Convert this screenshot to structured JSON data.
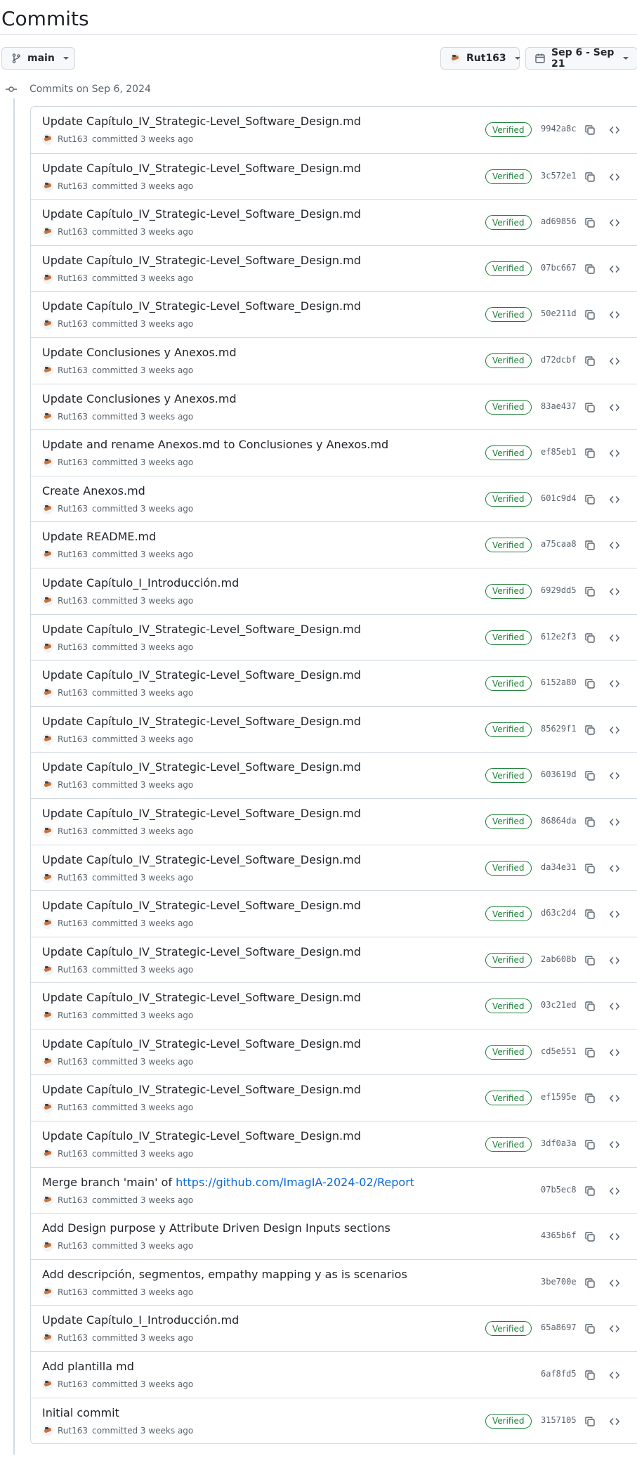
{
  "page": {
    "title": "Commits"
  },
  "filters": {
    "branch_label": "main",
    "author_label": "Rut163",
    "date_label": "Sep 6 - Sep 21"
  },
  "group": {
    "label": "Commits on Sep 6, 2024"
  },
  "commits": [
    {
      "title": "Update Capítulo_IV_Strategic-Level_Software_Design.md",
      "author": "Rut163",
      "meta": "committed 3 weeks ago",
      "verified": "Verified",
      "sha": "9942a8c"
    },
    {
      "title": "Update Capítulo_IV_Strategic-Level_Software_Design.md",
      "author": "Rut163",
      "meta": "committed 3 weeks ago",
      "verified": "Verified",
      "sha": "3c572e1"
    },
    {
      "title": "Update Capítulo_IV_Strategic-Level_Software_Design.md",
      "author": "Rut163",
      "meta": "committed 3 weeks ago",
      "verified": "Verified",
      "sha": "ad69856"
    },
    {
      "title": "Update Capítulo_IV_Strategic-Level_Software_Design.md",
      "author": "Rut163",
      "meta": "committed 3 weeks ago",
      "verified": "Verified",
      "sha": "07bc667"
    },
    {
      "title": "Update Capítulo_IV_Strategic-Level_Software_Design.md",
      "author": "Rut163",
      "meta": "committed 3 weeks ago",
      "verified": "Verified",
      "sha": "50e211d"
    },
    {
      "title": "Update Conclusiones y Anexos.md",
      "author": "Rut163",
      "meta": "committed 3 weeks ago",
      "verified": "Verified",
      "sha": "d72dcbf"
    },
    {
      "title": "Update Conclusiones y Anexos.md",
      "author": "Rut163",
      "meta": "committed 3 weeks ago",
      "verified": "Verified",
      "sha": "83ae437"
    },
    {
      "title": "Update and rename Anexos.md to Conclusiones y Anexos.md",
      "author": "Rut163",
      "meta": "committed 3 weeks ago",
      "verified": "Verified",
      "sha": "ef85eb1"
    },
    {
      "title": "Create Anexos.md",
      "author": "Rut163",
      "meta": "committed 3 weeks ago",
      "verified": "Verified",
      "sha": "601c9d4"
    },
    {
      "title": "Update README.md",
      "author": "Rut163",
      "meta": "committed 3 weeks ago",
      "verified": "Verified",
      "sha": "a75caa8"
    },
    {
      "title": "Update Capítulo_I_Introducción.md",
      "author": "Rut163",
      "meta": "committed 3 weeks ago",
      "verified": "Verified",
      "sha": "6929dd5"
    },
    {
      "title": "Update Capítulo_IV_Strategic-Level_Software_Design.md",
      "author": "Rut163",
      "meta": "committed 3 weeks ago",
      "verified": "Verified",
      "sha": "612e2f3"
    },
    {
      "title": "Update Capítulo_IV_Strategic-Level_Software_Design.md",
      "author": "Rut163",
      "meta": "committed 3 weeks ago",
      "verified": "Verified",
      "sha": "6152a80"
    },
    {
      "title": "Update Capítulo_IV_Strategic-Level_Software_Design.md",
      "author": "Rut163",
      "meta": "committed 3 weeks ago",
      "verified": "Verified",
      "sha": "85629f1"
    },
    {
      "title": "Update Capítulo_IV_Strategic-Level_Software_Design.md",
      "author": "Rut163",
      "meta": "committed 3 weeks ago",
      "verified": "Verified",
      "sha": "603619d"
    },
    {
      "title": "Update Capítulo_IV_Strategic-Level_Software_Design.md",
      "author": "Rut163",
      "meta": "committed 3 weeks ago",
      "verified": "Verified",
      "sha": "86864da"
    },
    {
      "title": "Update Capítulo_IV_Strategic-Level_Software_Design.md",
      "author": "Rut163",
      "meta": "committed 3 weeks ago",
      "verified": "Verified",
      "sha": "da34e31"
    },
    {
      "title": "Update Capítulo_IV_Strategic-Level_Software_Design.md",
      "author": "Rut163",
      "meta": "committed 3 weeks ago",
      "verified": "Verified",
      "sha": "d63c2d4"
    },
    {
      "title": "Update Capítulo_IV_Strategic-Level_Software_Design.md",
      "author": "Rut163",
      "meta": "committed 3 weeks ago",
      "verified": "Verified",
      "sha": "2ab608b"
    },
    {
      "title": "Update Capítulo_IV_Strategic-Level_Software_Design.md",
      "author": "Rut163",
      "meta": "committed 3 weeks ago",
      "verified": "Verified",
      "sha": "03c21ed"
    },
    {
      "title": "Update Capítulo_IV_Strategic-Level_Software_Design.md",
      "author": "Rut163",
      "meta": "committed 3 weeks ago",
      "verified": "Verified",
      "sha": "cd5e551"
    },
    {
      "title": "Update Capítulo_IV_Strategic-Level_Software_Design.md",
      "author": "Rut163",
      "meta": "committed 3 weeks ago",
      "verified": "Verified",
      "sha": "ef1595e"
    },
    {
      "title": "Update Capítulo_IV_Strategic-Level_Software_Design.md",
      "author": "Rut163",
      "meta": "committed 3 weeks ago",
      "verified": "Verified",
      "sha": "3df0a3a"
    },
    {
      "title": "Merge branch 'main' of ",
      "link": "https://github.com/ImagIA-2024-02/Report",
      "author": "Rut163",
      "meta": "committed 3 weeks ago",
      "verified": "",
      "sha": "07b5ec8"
    },
    {
      "title": "Add Design purpose y Attribute Driven Design Inputs sections",
      "author": "Rut163",
      "meta": "committed 3 weeks ago",
      "verified": "",
      "sha": "4365b6f"
    },
    {
      "title": "Add descripción, segmentos, empathy mapping y as is scenarios",
      "author": "Rut163",
      "meta": "committed 3 weeks ago",
      "verified": "",
      "sha": "3be700e"
    },
    {
      "title": "Update Capítulo_I_Introducción.md",
      "author": "Rut163",
      "meta": "committed 3 weeks ago",
      "verified": "Verified",
      "sha": "65a8697"
    },
    {
      "title": "Add plantilla md",
      "author": "Rut163",
      "meta": "committed 3 weeks ago",
      "verified": "",
      "sha": "6af8fd5"
    },
    {
      "title": "Initial commit",
      "author": "Rut163",
      "meta": "committed 3 weeks ago",
      "verified": "Verified",
      "sha": "3157105"
    }
  ],
  "icons": {
    "copy": "copy-icon",
    "browse": "code-icon",
    "branch": "git-branch-icon",
    "calendar": "calendar-icon",
    "commit": "git-commit-icon"
  },
  "colors": {
    "verified": "#1a7f37",
    "link": "#0969da",
    "border": "#d1d9e0",
    "muted": "#59636e"
  }
}
